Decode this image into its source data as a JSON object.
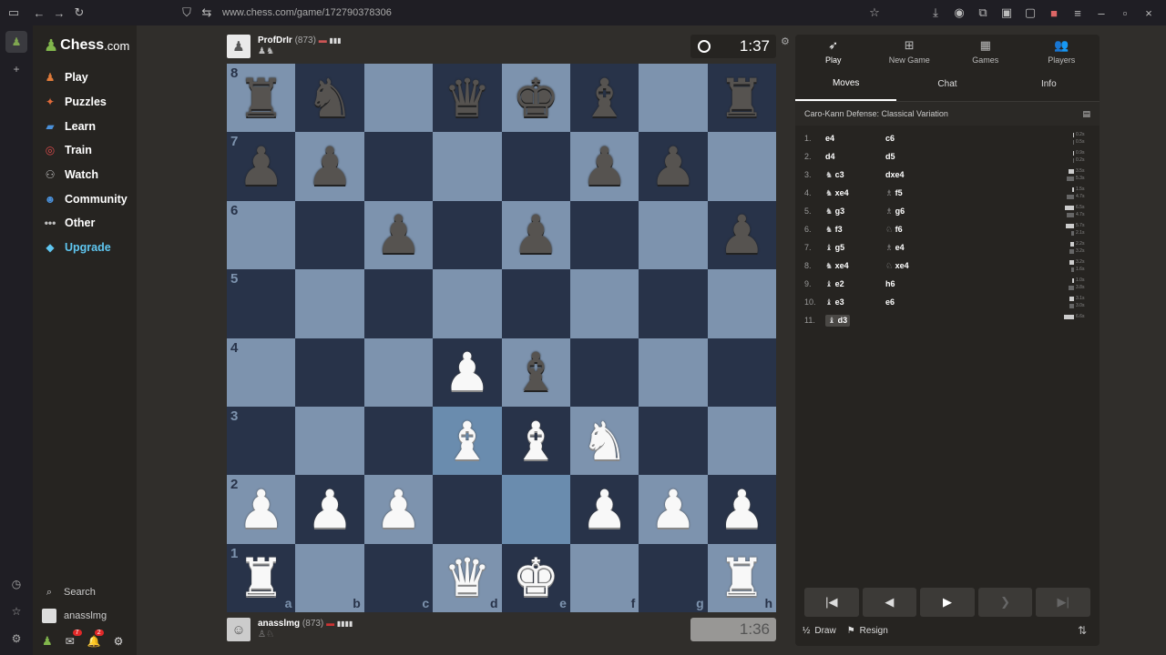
{
  "browser": {
    "url": "www.chess.com/game/172790378306"
  },
  "sidebar": {
    "logo": {
      "main": "Chess",
      "suffix": ".com"
    },
    "items": [
      {
        "label": "Play",
        "icon": "play-icon",
        "color": "#e07b3a"
      },
      {
        "label": "Puzzles",
        "icon": "puzzle-icon",
        "color": "#e06a3a"
      },
      {
        "label": "Learn",
        "icon": "learn-icon",
        "color": "#4a90d9"
      },
      {
        "label": "Train",
        "icon": "train-icon",
        "color": "#d94a4a"
      },
      {
        "label": "Watch",
        "icon": "binoculars-icon",
        "color": "#c0c0c0"
      },
      {
        "label": "Community",
        "icon": "community-icon",
        "color": "#4a90d9"
      },
      {
        "label": "Other",
        "icon": "more-icon",
        "color": "#c0c0c0"
      },
      {
        "label": "Upgrade",
        "icon": "diamond-icon",
        "color": "#5fc6f0"
      }
    ],
    "search": "Search",
    "user": "anasslmg",
    "badges": {
      "messages": "7",
      "notifications": "2"
    }
  },
  "top_player": {
    "name": "ProfDrIr",
    "rating": "(873)",
    "clock": "1:37"
  },
  "bottom_player": {
    "name": "anasslmg",
    "rating": "(873)",
    "clock": "1:36"
  },
  "board": {
    "ranks": [
      "8",
      "7",
      "6",
      "5",
      "4",
      "3",
      "2",
      "1"
    ],
    "files": [
      "a",
      "b",
      "c",
      "d",
      "e",
      "f",
      "g",
      "h"
    ],
    "position": [
      [
        "br",
        "bn",
        "",
        "bq",
        "bk",
        "bb",
        "",
        "br"
      ],
      [
        "bp",
        "bp",
        "",
        "",
        "",
        "bp",
        "bp",
        ""
      ],
      [
        "",
        "",
        "bp",
        "",
        "bp",
        "",
        "",
        "bp"
      ],
      [
        "",
        "",
        "",
        "",
        "",
        "",
        "",
        ""
      ],
      [
        "",
        "",
        "",
        "wp",
        "bb",
        "",
        "",
        ""
      ],
      [
        "",
        "",
        "",
        "wb",
        "wb",
        "wn",
        "",
        ""
      ],
      [
        "wp",
        "wp",
        "wp",
        "",
        "",
        "wp",
        "wp",
        "wp"
      ],
      [
        "wr",
        "",
        "",
        "wq",
        "wk",
        "",
        "",
        "wr"
      ]
    ],
    "highlight": [
      "d3",
      "e2"
    ]
  },
  "panel": {
    "tabs": [
      {
        "label": "Play",
        "icon": "play-icon"
      },
      {
        "label": "New Game",
        "icon": "plus-icon"
      },
      {
        "label": "Games",
        "icon": "board-icon"
      },
      {
        "label": "Players",
        "icon": "players-icon"
      }
    ],
    "subtabs": [
      "Moves",
      "Chat",
      "Info"
    ],
    "opening": "Caro-Kann Defense: Classical Variation",
    "moves": [
      {
        "no": "1.",
        "w": "e4",
        "wp": "",
        "b": "c6",
        "bp": "",
        "tw": "0.2s",
        "tb": "0.5s"
      },
      {
        "no": "2.",
        "w": "d4",
        "wp": "",
        "b": "d5",
        "bp": "",
        "tw": "0.9s",
        "tb": "0.2s"
      },
      {
        "no": "3.",
        "w": "c3",
        "wp": "N",
        "b": "dxe4",
        "bp": "",
        "tw": "3.5s",
        "tb": "5.3s"
      },
      {
        "no": "4.",
        "w": "xe4",
        "wp": "N",
        "b": "f5",
        "bp": "B",
        "tw": "1.5s",
        "tb": "4.7s"
      },
      {
        "no": "5.",
        "w": "g3",
        "wp": "N",
        "b": "g6",
        "bp": "B",
        "tw": "6.5s",
        "tb": "4.7s"
      },
      {
        "no": "6.",
        "w": "f3",
        "wp": "N",
        "b": "f6",
        "bp": "N",
        "tw": "5.7s",
        "tb": "2.1s"
      },
      {
        "no": "7.",
        "w": "g5",
        "wp": "B",
        "b": "e4",
        "bp": "B",
        "tw": "2.2s",
        "tb": "3.2s"
      },
      {
        "no": "8.",
        "w": "xe4",
        "wp": "N",
        "b": "xe4",
        "bp": "N",
        "tw": "3.2s",
        "tb": "1.6s"
      },
      {
        "no": "9.",
        "w": "e2",
        "wp": "B",
        "b": "h6",
        "bp": "",
        "tw": "1.0s",
        "tb": "3.8s"
      },
      {
        "no": "10.",
        "w": "e3",
        "wp": "B",
        "b": "e6",
        "bp": "",
        "tw": "3.1s",
        "tb": "3.0s"
      },
      {
        "no": "11.",
        "w": "d3",
        "wp": "B",
        "b": "",
        "bp": "",
        "tw": "6.6s",
        "tb": ""
      }
    ],
    "draw": "Draw",
    "draw_prefix": "½",
    "resign": "Resign"
  }
}
